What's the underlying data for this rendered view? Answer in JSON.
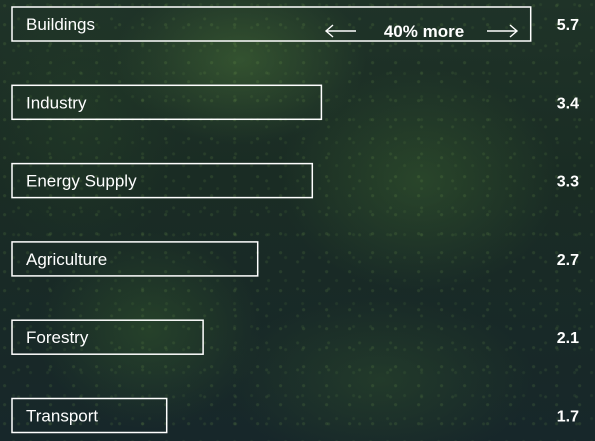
{
  "chart_data": {
    "type": "bar",
    "orientation": "horizontal",
    "categories": [
      "Buildings",
      "Industry",
      "Energy Supply",
      "Agriculture",
      "Forestry",
      "Transport"
    ],
    "values": [
      5.7,
      3.4,
      3.3,
      2.7,
      2.1,
      1.7
    ],
    "value_labels": [
      "5.7",
      "3.4",
      "3.3",
      "2.7",
      "2.1",
      "1.7"
    ],
    "annotation": {
      "text": "40% more",
      "category": "Buildings"
    },
    "colors": {
      "bar_outline": "#ffffff",
      "text": "#ffffff"
    }
  }
}
